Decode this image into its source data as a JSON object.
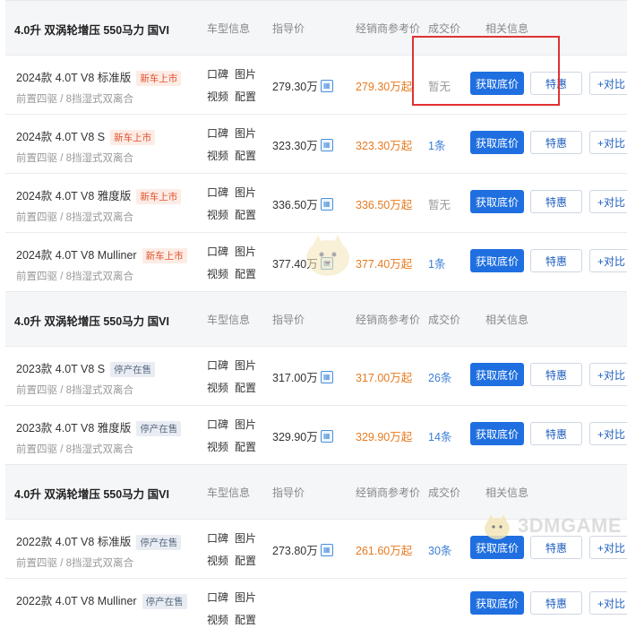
{
  "columns": {
    "model": "车型信息",
    "guide": "指导价",
    "dealer": "经销商参考价",
    "deal": "成交价",
    "related": "相关信息"
  },
  "links": {
    "koubei": "口碑",
    "tupian": "图片",
    "shipin": "视频",
    "peizhi": "配置"
  },
  "buttons": {
    "get_price": "获取底价",
    "special": "特惠",
    "compare": "+对比"
  },
  "groups": [
    {
      "spec": "4.0升 双涡轮增压 550马力 国VI",
      "rows": [
        {
          "name": "2024款 4.0T V8 标准版",
          "badge": "新车上市",
          "badge_type": "new",
          "sub": "前置四驱 / 8挡湿式双离合",
          "guide": "279.30万",
          "dealer": "279.30万起",
          "deal": "暂无"
        },
        {
          "name": "2024款 4.0T V8 S",
          "badge": "新车上市",
          "badge_type": "new",
          "sub": "前置四驱 / 8挡湿式双离合",
          "guide": "323.30万",
          "dealer": "323.30万起",
          "deal": "1条"
        },
        {
          "name": "2024款 4.0T V8 雅度版",
          "badge": "新车上市",
          "badge_type": "new",
          "sub": "前置四驱 / 8挡湿式双离合",
          "guide": "336.50万",
          "dealer": "336.50万起",
          "deal": "暂无"
        },
        {
          "name": "2024款 4.0T V8 Mulliner",
          "badge": "新车上市",
          "badge_type": "new",
          "sub": "前置四驱 / 8挡湿式双离合",
          "guide": "377.40万",
          "dealer": "377.40万起",
          "deal": "1条"
        }
      ]
    },
    {
      "spec": "4.0升 双涡轮增压 550马力 国VI",
      "rows": [
        {
          "name": "2023款 4.0T V8 S",
          "badge": "停产在售",
          "badge_type": "stop",
          "sub": "前置四驱 / 8挡湿式双离合",
          "guide": "317.00万",
          "dealer": "317.00万起",
          "deal": "26条"
        },
        {
          "name": "2023款 4.0T V8 雅度版",
          "badge": "停产在售",
          "badge_type": "stop",
          "sub": "前置四驱 / 8挡湿式双离合",
          "guide": "329.90万",
          "dealer": "329.90万起",
          "deal": "14条"
        }
      ]
    },
    {
      "spec": "4.0升 双涡轮增压 550马力 国VI",
      "rows": [
        {
          "name": "2022款 4.0T V8 标准版",
          "badge": "停产在售",
          "badge_type": "stop",
          "sub": "前置四驱 / 8挡湿式双离合",
          "guide": "273.80万",
          "dealer": "261.60万起",
          "deal": "30条"
        },
        {
          "name": "2022款 4.0T V8 Mulliner",
          "badge": "停产在售",
          "badge_type": "stop",
          "sub": "",
          "guide": "",
          "dealer": "",
          "deal": ""
        }
      ]
    }
  ],
  "watermark": "3DMGAME",
  "colors": {
    "primary_button": "#1f6fe0",
    "dealer_price": "#e87a1f",
    "deal_link": "#3b7ed6",
    "highlight_box": "#e03131",
    "new_badge": "#e0502b"
  }
}
